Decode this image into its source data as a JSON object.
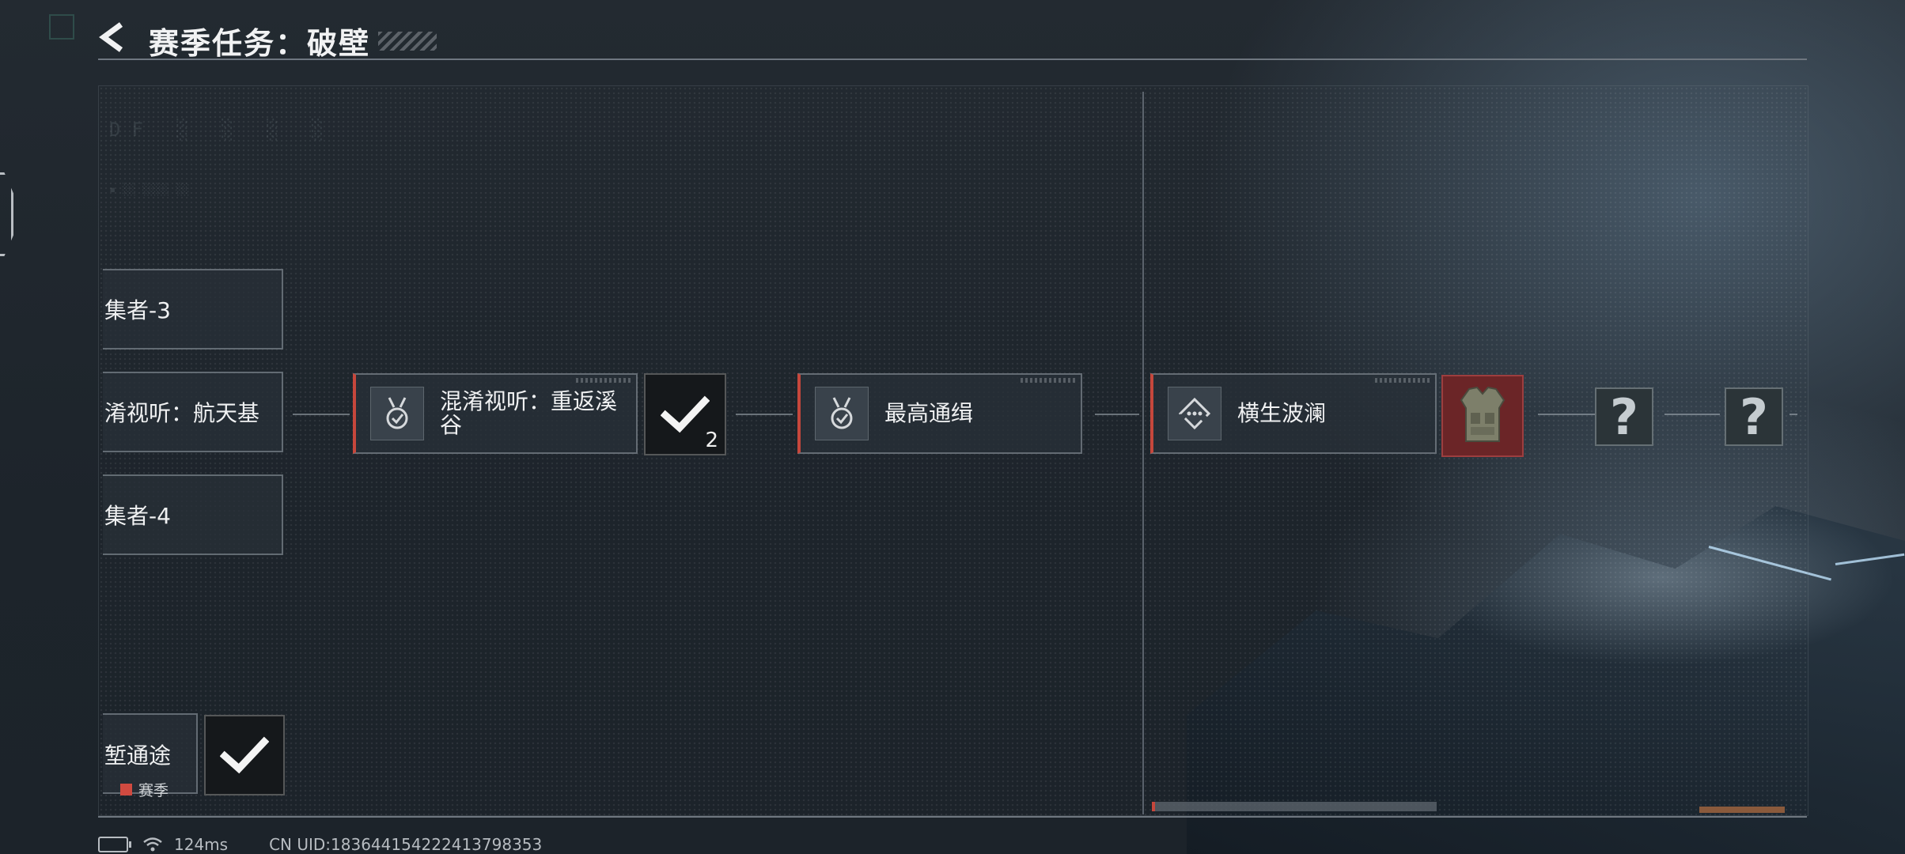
{
  "header": {
    "title": "赛季任务：破壁"
  },
  "side_nodes": [
    {
      "label": "集者-3"
    },
    {
      "label": "淆视听：航天基"
    },
    {
      "label": "集者-4"
    },
    {
      "label": "堑通途",
      "tag": "赛季"
    }
  ],
  "chain": [
    {
      "label": "混淆视听：重返溪\n谷",
      "icon": "medal-check-icon"
    },
    {
      "label": "最高通缉",
      "icon": "medal-check-icon"
    },
    {
      "label": "横生波澜",
      "icon": "diamond-dots-icon"
    }
  ],
  "rewards": {
    "done_count": "2",
    "unknown_symbol": "?"
  },
  "status_bar": {
    "ping": "124ms",
    "uid": "CN UID:1836441542224137983​53"
  },
  "colors": {
    "accent_red": "#c6473c",
    "reward_red": "#6b2527"
  }
}
